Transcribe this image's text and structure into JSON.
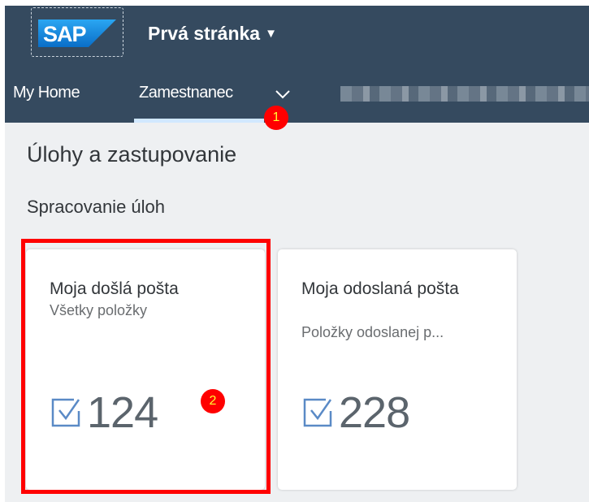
{
  "shell": {
    "logo_text": "SAP",
    "page_title": "Prvá stránka",
    "tabs": [
      {
        "label": "My Home"
      },
      {
        "label": "Zamestnanec"
      }
    ]
  },
  "annotations": {
    "badge1": "1",
    "badge2": "2"
  },
  "content": {
    "section_title": "Úlohy a zastupovanie",
    "group_title": "Spracovanie úloh",
    "tiles": [
      {
        "title": "Moja došlá pošta",
        "subtitle": "Všetky položky",
        "value": "124"
      },
      {
        "title": "Moja odoslaná pošta",
        "subtitle": "Položky odoslanej p...",
        "value": "228"
      }
    ]
  },
  "colors": {
    "shell_bg": "#354a5f",
    "content_bg": "#eef0f2",
    "tab_underline": "#d1e8ff",
    "annotation_red": "#ff0000",
    "sap_blue": "#1a7fd5",
    "kpi_icon": "#5a8ac6"
  },
  "icons": {
    "dropdown": "caret-down-icon",
    "tab_menu": "chevron-down-icon",
    "kpi": "checkbox-icon"
  }
}
